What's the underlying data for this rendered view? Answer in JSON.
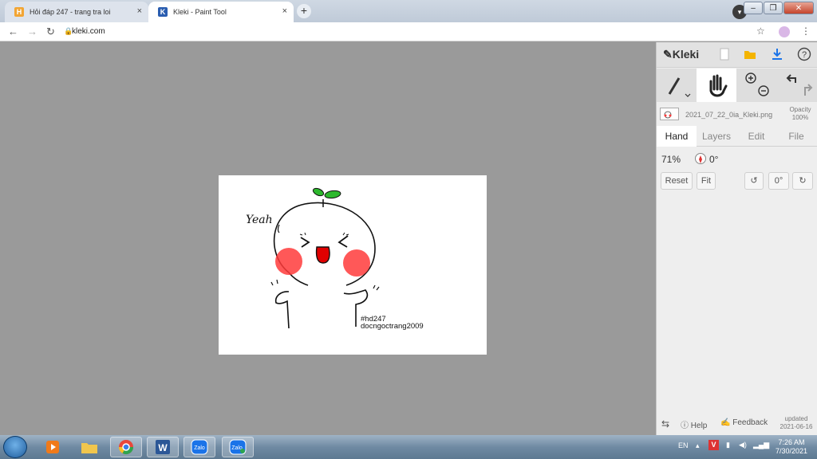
{
  "browser": {
    "tabs": [
      {
        "title": "Hỏi đáp 247 - trang tra loi",
        "favicon": "H",
        "close": "×"
      },
      {
        "title": "Kleki - Paint Tool",
        "favicon": "K",
        "close": "×"
      }
    ],
    "newtab": "+",
    "url": "kleki.com",
    "window_controls": {
      "min": "–",
      "max": "❐",
      "close": "✕"
    }
  },
  "drawing": {
    "speech": "Yeah",
    "tag1": "#hd247",
    "tag2": "docngoctrang2009"
  },
  "panel": {
    "brand": "Kleki",
    "filename": "2021_07_22_0ia_Kleki.png",
    "opacity_label": "Opacity",
    "opacity_value": "100%",
    "tabs": [
      "Hand",
      "Layers",
      "Edit",
      "File"
    ],
    "zoom": "71%",
    "angle": "0°",
    "buttons": {
      "reset": "Reset",
      "fit": "Fit",
      "rot_value": "0°"
    },
    "footer": {
      "help": "Help",
      "feedback": "Feedback",
      "updated": "updated",
      "date": "2021-06-16"
    }
  },
  "taskbar": {
    "lang": "EN",
    "time": "7:26 AM",
    "date": "7/30/2021",
    "zalo1": "Zalo",
    "zalo2": "Zalo"
  },
  "colors": {
    "blush": "#ff3b3b",
    "leaf": "#2db82d",
    "tongue": "#e00000",
    "accent_download": "#1a73e8"
  }
}
